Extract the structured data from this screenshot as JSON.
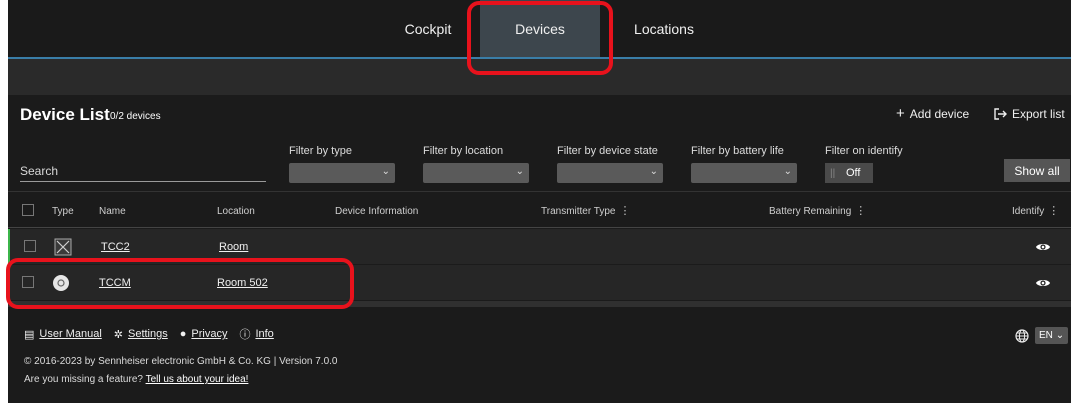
{
  "nav": {
    "tabs": [
      {
        "label": "Cockpit"
      },
      {
        "label": "Devices",
        "active": true
      },
      {
        "label": "Locations"
      }
    ]
  },
  "header": {
    "title": "Device List",
    "count": "0/2 devices",
    "add_label": "Add device",
    "export_label": "Export list"
  },
  "filters": {
    "search_placeholder": "Search",
    "type_label": "Filter by type",
    "location_label": "Filter by location",
    "state_label": "Filter by device state",
    "battery_label": "Filter by battery life",
    "identify_label": "Filter on identify",
    "identify_value": "Off",
    "show_all": "Show all"
  },
  "table": {
    "columns": {
      "type": "Type",
      "name": "Name",
      "location": "Location",
      "info": "Device Information",
      "transmitter": "Transmitter Type",
      "battery": "Battery Remaining",
      "identify": "Identify"
    },
    "rows": [
      {
        "type_icon": "x-box-icon",
        "name": "TCC2",
        "location": "Room"
      },
      {
        "type_icon": "disc-icon",
        "name": "TCCM",
        "location": "Room 502"
      }
    ]
  },
  "footer": {
    "manual": "User Manual",
    "settings": "Settings",
    "privacy": "Privacy",
    "info": "Info",
    "copyright": "© 2016-2023 by Sennheiser electronic GmbH & Co. KG | Version 7.0.0",
    "missing_text": "Are you missing a feature?",
    "missing_link": "Tell us about your idea!",
    "language": "EN"
  },
  "colors": {
    "accent": "#3a7ea8",
    "active_tab": "#3d464d",
    "highlight": "#e8121c",
    "online": "#3bb54a"
  }
}
